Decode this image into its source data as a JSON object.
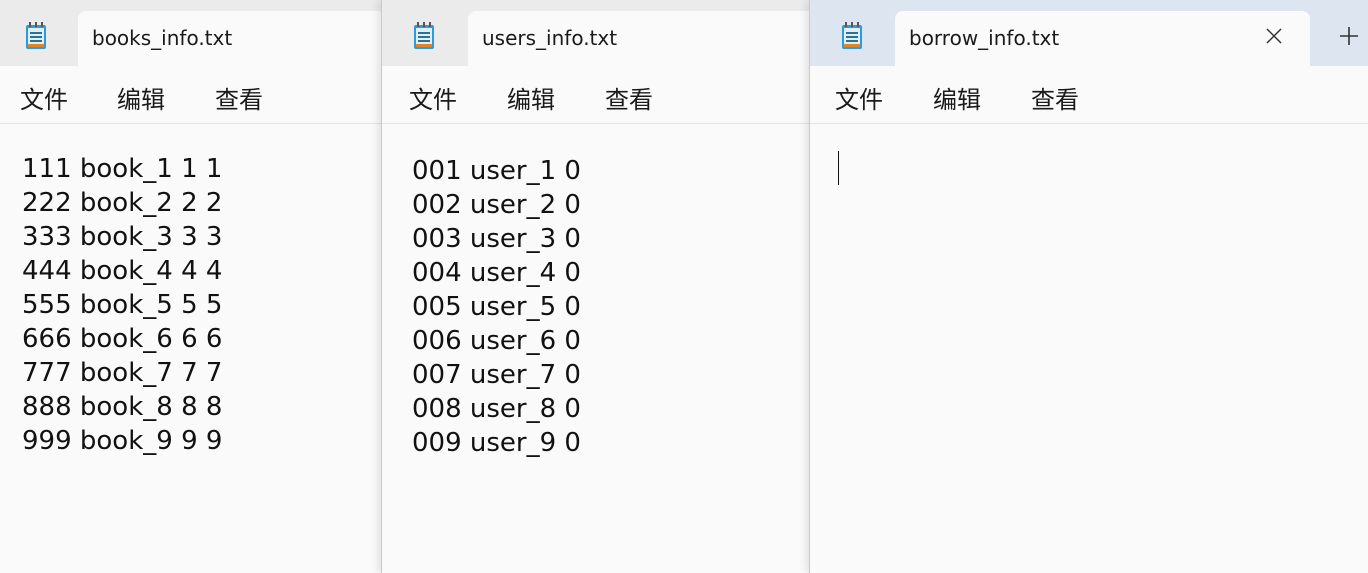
{
  "windows": {
    "books": {
      "tab_title": "books_info.txt",
      "menu": [
        "文件",
        "编辑",
        "查看"
      ],
      "lines": [
        "111 book_1 1 1",
        "222 book_2 2 2",
        "333 book_3 3 3",
        "444 book_4 4 4",
        "555 book_5 5 5",
        "666 book_6 6 6",
        "777 book_7 7 7",
        "888 book_8 8 8",
        "999 book_9 9 9"
      ]
    },
    "users": {
      "tab_title": "users_info.txt",
      "menu": [
        "文件",
        "编辑",
        "查看"
      ],
      "lines": [
        "001 user_1 0",
        "002 user_2 0",
        "003 user_3 0",
        "004 user_4 0",
        "005 user_5 0",
        "006 user_6 0",
        "007 user_7 0",
        "008 user_8 0",
        "009 user_9 0"
      ]
    },
    "borrow": {
      "tab_title": "borrow_info.txt",
      "menu": [
        "文件",
        "编辑",
        "查看"
      ],
      "lines": []
    }
  },
  "icons": {
    "app": "notepad-icon",
    "close": "close-icon",
    "new_tab": "plus-icon"
  },
  "colors": {
    "active_titlebar": "#dde6f0",
    "inactive_titlebar": "#ebebeb",
    "editor_bg": "#fafafa"
  }
}
